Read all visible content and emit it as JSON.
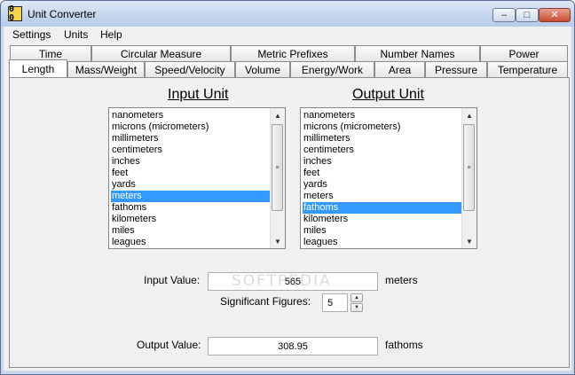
{
  "window": {
    "title": "Unit Converter",
    "app_icon_glyph": "0 0"
  },
  "menubar": {
    "items": [
      "Settings",
      "Units",
      "Help"
    ]
  },
  "tabs": {
    "row1": [
      "Time",
      "Circular Measure",
      "Metric Prefixes",
      "Number Names",
      "Power"
    ],
    "row2": [
      "Length",
      "Mass/Weight",
      "Speed/Velocity",
      "Volume",
      "Energy/Work",
      "Area",
      "Pressure",
      "Temperature"
    ],
    "active": "Length"
  },
  "input_unit": {
    "heading": "Input Unit",
    "items": [
      "nanometers",
      "microns (micrometers)",
      "millimeters",
      "centimeters",
      "inches",
      "feet",
      "yards",
      "meters",
      "fathoms",
      "kilometers",
      "miles",
      "leagues"
    ],
    "selected": "meters"
  },
  "output_unit": {
    "heading": "Output Unit",
    "items": [
      "nanometers",
      "microns (micrometers)",
      "millimeters",
      "centimeters",
      "inches",
      "feet",
      "yards",
      "meters",
      "fathoms",
      "kilometers",
      "miles",
      "leagues"
    ],
    "selected": "fathoms"
  },
  "form": {
    "input_label": "Input Value:",
    "input_value": "565",
    "input_unit_label": "meters",
    "sig_label": "Significant Figures:",
    "sig_value": "5",
    "output_label": "Output Value:",
    "output_value": "308.95",
    "output_unit_label": "fathoms"
  },
  "watermark": "SOFTPEDIA",
  "colors": {
    "selection": "#3399ff",
    "titlebar": "#c7d6ea",
    "close_button": "#c94b32"
  }
}
